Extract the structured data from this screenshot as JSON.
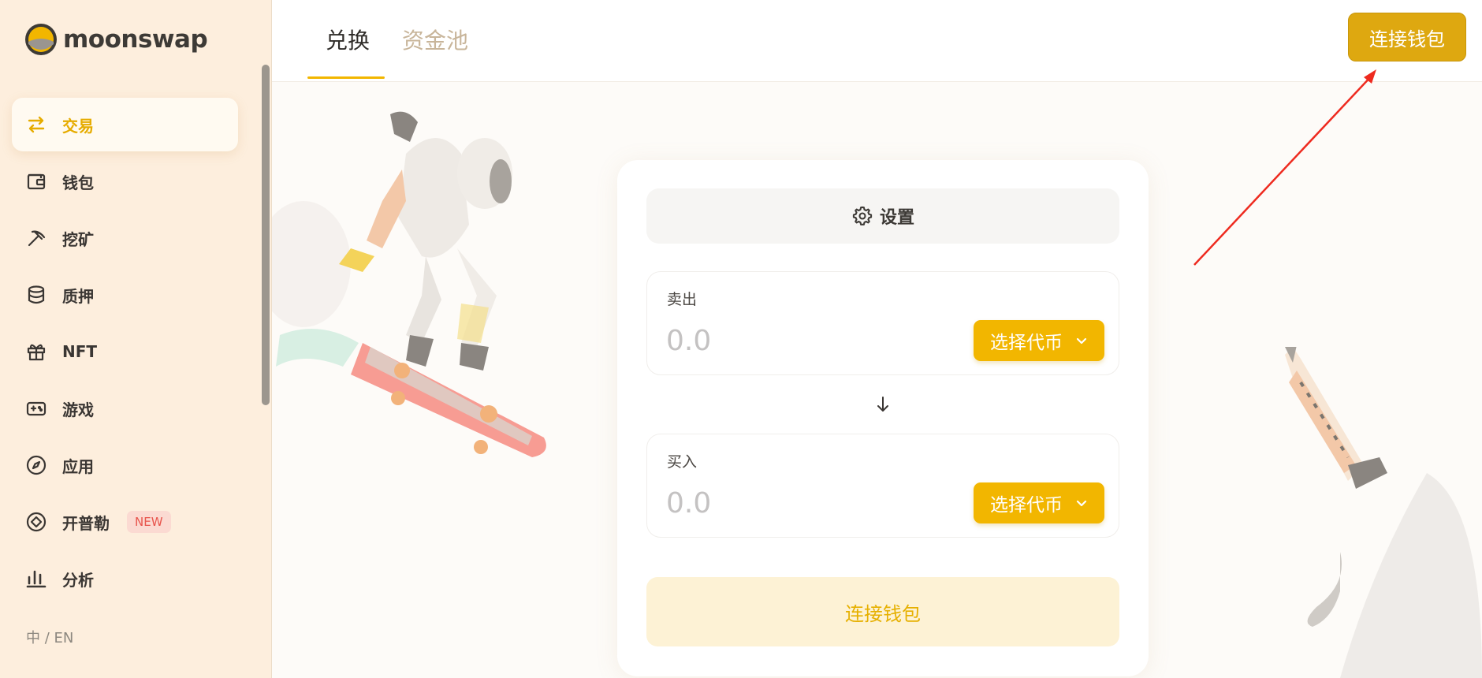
{
  "brand": {
    "name": "moonswap"
  },
  "sidebar": {
    "items": [
      {
        "label": "交易",
        "icon": "swap-arrows-icon"
      },
      {
        "label": "钱包",
        "icon": "wallet-icon"
      },
      {
        "label": "挖矿",
        "icon": "pickaxe-icon"
      },
      {
        "label": "质押",
        "icon": "database-icon"
      },
      {
        "label": "NFT",
        "icon": "gift-icon"
      },
      {
        "label": "游戏",
        "icon": "gamepad-icon"
      },
      {
        "label": "应用",
        "icon": "compass-icon"
      },
      {
        "label": "开普勒",
        "icon": "kepler-icon",
        "badge": "NEW"
      },
      {
        "label": "分析",
        "icon": "bar-chart-icon"
      }
    ],
    "active_index": 0,
    "language": "中 / EN"
  },
  "header": {
    "tabs": [
      {
        "label": "兑换"
      },
      {
        "label": "资金池"
      }
    ],
    "connect_label": "连接钱包"
  },
  "swap": {
    "settings_label": "设置",
    "sell": {
      "label": "卖出",
      "placeholder": "0.0",
      "token_label": "选择代币"
    },
    "buy": {
      "label": "买入",
      "placeholder": "0.0",
      "token_label": "选择代币"
    },
    "connect_label": "连接钱包"
  },
  "colors": {
    "accent": "#f2b600",
    "sidebar_bg": "#fdeedd",
    "badge_text": "#e8554d",
    "annotation_arrow": "#ee2a1f"
  }
}
